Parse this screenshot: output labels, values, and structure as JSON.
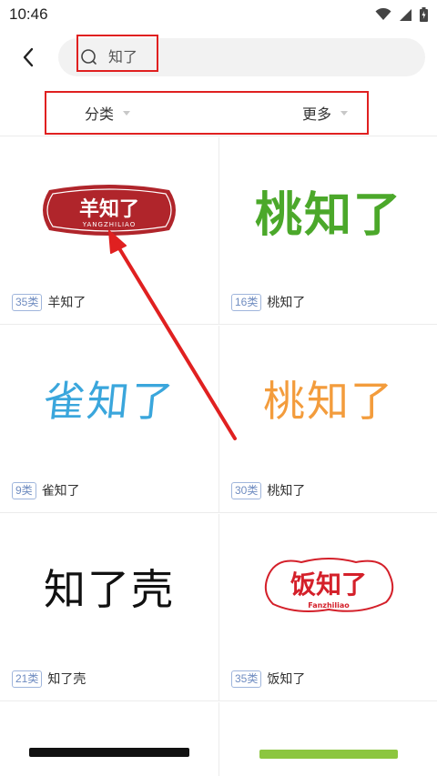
{
  "status_bar": {
    "time": "10:46",
    "icons": [
      "wifi-icon",
      "signal-icon",
      "battery-icon"
    ]
  },
  "search": {
    "query": "知了"
  },
  "filters": {
    "category_label": "分类",
    "more_label": "更多"
  },
  "results": [
    {
      "badge": "35类",
      "name": "羊知了",
      "logo_text": "羊知了",
      "logo_subtext": "YANGZHILIAO",
      "color": "#b0252b"
    },
    {
      "badge": "16类",
      "name": "桃知了",
      "logo_text": "桃知了",
      "color": "#4ba82a"
    },
    {
      "badge": "9类",
      "name": "雀知了",
      "logo_text": "雀知了",
      "color": "#3aa6dc"
    },
    {
      "badge": "30类",
      "name": "桃知了",
      "logo_text": "桃知了",
      "color": "#f39c3c"
    },
    {
      "badge": "21类",
      "name": "知了壳",
      "logo_text": "知了壳",
      "color": "#111111"
    },
    {
      "badge": "35类",
      "name": "饭知了",
      "logo_text": "饭知了",
      "logo_subtext": "Fanzhiliao",
      "color": "#d4202a"
    }
  ],
  "colors": {
    "annotation_red": "#e02020",
    "badge_blue": "#6f8cc0"
  }
}
